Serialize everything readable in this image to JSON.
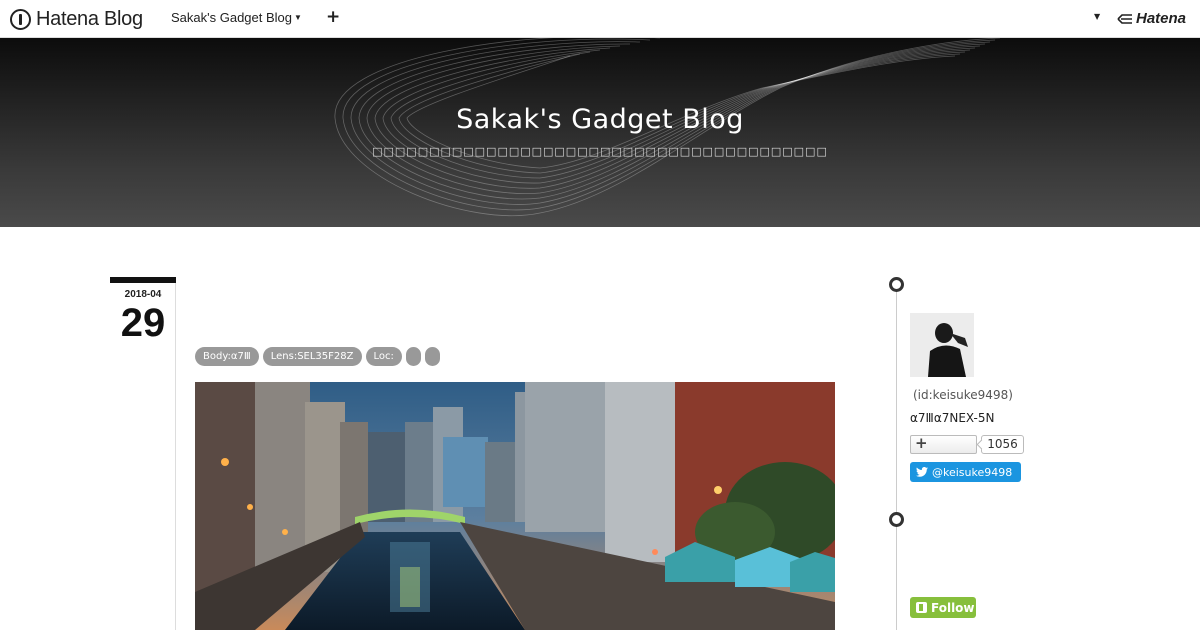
{
  "globalbar": {
    "logo_text": "Hatena Blog",
    "blog_switch_label": "Sakak's Gadget Blog",
    "plus_label": "+",
    "brand_text": "Hatena"
  },
  "header": {
    "title": "Sakak's Gadget Blog",
    "description": "□□□□□□□□□□□□□□□□□□□□□□□□□□□□□□□□□□□□□□□□"
  },
  "entry": {
    "date_year_month": "2018-04",
    "date_day": "29",
    "tags": [
      "Body:α7Ⅲ",
      "Lens:SEL35F28Z",
      "Loc:",
      "",
      ""
    ]
  },
  "sidebar": {
    "user_id": "(id:keisuke9498)",
    "user_desc": "α7Ⅲα7NEX-5N",
    "subscribe_label": "+",
    "subscriber_count": "1056",
    "twitter_label": "@keisuke9498",
    "follow_label": "Follow"
  },
  "colors": {
    "twitter": "#1b95e0",
    "follow": "#87bf3c",
    "tag": "#999999"
  }
}
